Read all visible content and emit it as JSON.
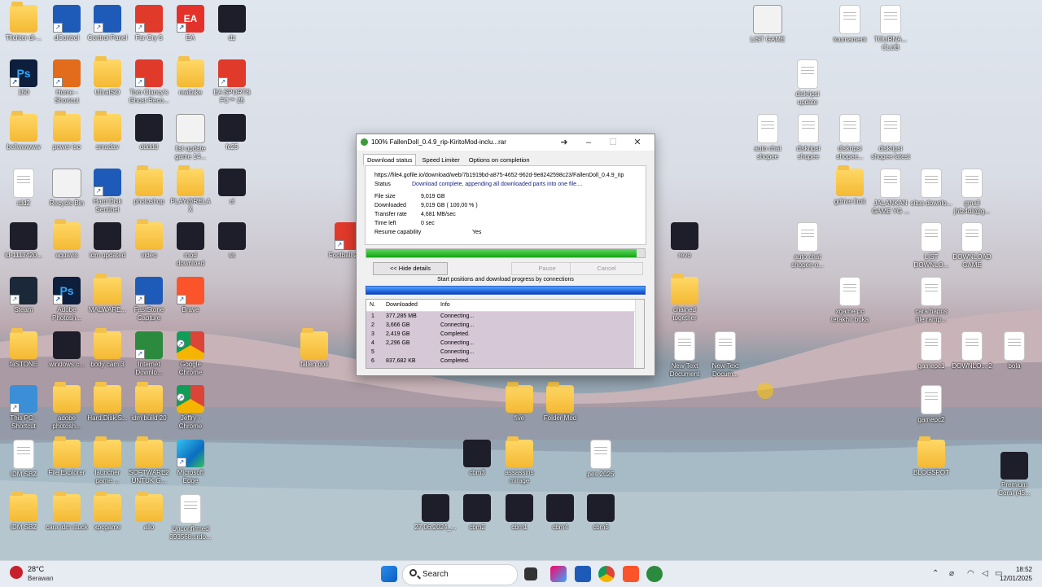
{
  "desktop_icons": [
    {
      "label": "Tfichter dl-...",
      "icon": "folder-icon"
    },
    {
      "label": "dControl",
      "icon": "app-icon"
    },
    {
      "label": "Control Panel",
      "icon": "control-panel-icon"
    },
    {
      "label": "Far Cry 5",
      "icon": "game-icon"
    },
    {
      "label": "EA",
      "icon": "ea-icon"
    },
    {
      "label": "dz",
      "icon": "image-icon"
    },
    {
      "label": "LIST GAME",
      "icon": "excel-icon"
    },
    {
      "label": "tournament",
      "icon": "document-icon"
    },
    {
      "label": "TOURNA... CLUB",
      "icon": "document-icon"
    },
    {
      "label": "150",
      "icon": "photoshop-icon"
    },
    {
      "label": "Home - Shortcut",
      "icon": "home-icon"
    },
    {
      "label": "UltraISO",
      "icon": "folder-icon"
    },
    {
      "label": "Tom Clancy's Ghost Reco...",
      "icon": "game-icon"
    },
    {
      "label": "realtake",
      "icon": "folder-icon"
    },
    {
      "label": "EA SPORTS FC™ 25",
      "icon": "game-icon"
    },
    {
      "label": "diskripsi update",
      "icon": "document-icon"
    },
    {
      "label": "bellwwwww",
      "icon": "folder-icon"
    },
    {
      "label": "power iso",
      "icon": "folder-icon"
    },
    {
      "label": "smadav",
      "icon": "folder-icon"
    },
    {
      "label": "ddddd",
      "icon": "image-icon"
    },
    {
      "label": "list update game 14...",
      "icon": "excel-icon"
    },
    {
      "label": "fc25",
      "icon": "image-icon"
    },
    {
      "label": "auto chat shopee",
      "icon": "document-icon"
    },
    {
      "label": "diskripsi shopee",
      "icon": "document-icon"
    },
    {
      "label": "diskripsi shopee...",
      "icon": "document-icon"
    },
    {
      "label": "diskripsi shopee latest",
      "icon": "document-icon"
    },
    {
      "label": "rdd2",
      "icon": "document-icon"
    },
    {
      "label": "Recycle Bin",
      "icon": "recycle-bin-icon"
    },
    {
      "label": "Hard Disk Sentinel",
      "icon": "app-icon"
    },
    {
      "label": "photoshop",
      "icon": "folder-icon"
    },
    {
      "label": "PLAY@RELAX",
      "icon": "folder-icon"
    },
    {
      "label": "cl",
      "icon": "video-icon"
    },
    {
      "label": "gdrive limit",
      "icon": "folder-icon"
    },
    {
      "label": "JALANKAN GAME YG ...",
      "icon": "document-icon"
    },
    {
      "label": "situs downlo...",
      "icon": "document-icon"
    },
    {
      "label": "gmail jhfz4dll@g...",
      "icon": "document-icon"
    },
    {
      "label": "id-1113420...",
      "icon": "image-icon"
    },
    {
      "label": "aquavis",
      "icon": "folder-icon"
    },
    {
      "label": "idm updated",
      "icon": "image-icon"
    },
    {
      "label": "video",
      "icon": "folder-icon"
    },
    {
      "label": "mod download",
      "icon": "image-icon"
    },
    {
      "label": "ss",
      "icon": "image-icon"
    },
    {
      "label": "Football 2025",
      "icon": "game-icon"
    },
    {
      "label": "revo",
      "icon": "image-icon"
    },
    {
      "label": "auto chat shopee o...",
      "icon": "document-icon"
    },
    {
      "label": "LIST DOWNLO...",
      "icon": "document-icon"
    },
    {
      "label": "DOWNLOAD GAME",
      "icon": "document-icon"
    },
    {
      "label": "Steam",
      "icon": "steam-icon"
    },
    {
      "label": "Adobe Photosh...",
      "icon": "photoshop-icon"
    },
    {
      "label": "MALWARE...",
      "icon": "folder-icon"
    },
    {
      "label": "FastStone Capture",
      "icon": "app-icon"
    },
    {
      "label": "Brave",
      "icon": "brave-icon"
    },
    {
      "label": "chained together",
      "icon": "folder-icon"
    },
    {
      "label": "xgame pc terakhir buka",
      "icon": "document-icon"
    },
    {
      "label": "cara hapus file ramp...",
      "icon": "document-icon"
    },
    {
      "label": "faSTONE",
      "icon": "folder-icon"
    },
    {
      "label": "windows c...",
      "icon": "image-icon"
    },
    {
      "label": "body cam 3",
      "icon": "folder-icon"
    },
    {
      "label": "Internet Downlo...",
      "icon": "idm-icon"
    },
    {
      "label": "Google Chrome",
      "icon": "chrome-icon"
    },
    {
      "label": "fallen doll",
      "icon": "folder-icon"
    },
    {
      "label": "New Text Document",
      "icon": "document-icon"
    },
    {
      "label": "New Text Docum...",
      "icon": "document-icon"
    },
    {
      "label": "gamepc1",
      "icon": "document-icon"
    },
    {
      "label": "DOWNLO... 2",
      "icon": "document-icon"
    },
    {
      "label": "bola",
      "icon": "document-icon"
    },
    {
      "label": "This PC - Shortcut",
      "icon": "this-pc-icon"
    },
    {
      "label": "adobe photosh...",
      "icon": "folder-icon"
    },
    {
      "label": "Hard.Disk.S...",
      "icon": "folder-icon"
    },
    {
      "label": "idm build 20",
      "icon": "folder-icon"
    },
    {
      "label": "Jeffry - Chrome",
      "icon": "chrome-icon"
    },
    {
      "label": "five",
      "icon": "folder-icon"
    },
    {
      "label": "Folder Mod",
      "icon": "folder-icon"
    },
    {
      "label": "gamepc2",
      "icon": "document-icon"
    },
    {
      "label": "IDM SBZ",
      "icon": "document-icon"
    },
    {
      "label": "File Explorer",
      "icon": "file-explorer-icon"
    },
    {
      "label": "launcher game ...",
      "icon": "folder-icon"
    },
    {
      "label": "SOFTWARE2 UNTUK G...",
      "icon": "folder-icon"
    },
    {
      "label": "Microsoft Edge",
      "icon": "edge-icon"
    },
    {
      "label": "cbm3",
      "icon": "image-icon"
    },
    {
      "label": "assassins mirage",
      "icon": "folder-icon"
    },
    {
      "label": "pes 2025",
      "icon": "document-icon"
    },
    {
      "label": "BLOGSPOT",
      "icon": "folder-icon"
    },
    {
      "label": "Premium Coral (45...",
      "icon": "image-icon"
    },
    {
      "label": "IDM SBZ",
      "icon": "folder-icon"
    },
    {
      "label": "cara idm stuck",
      "icon": "folder-icon"
    },
    {
      "label": "xpcgame",
      "icon": "folder-icon"
    },
    {
      "label": "allo",
      "icon": "folder-icon"
    },
    {
      "label": "Unconfirmed 393568.crdo...",
      "icon": "document-icon"
    },
    {
      "label": "27.06.2024_...",
      "icon": "image-icon"
    },
    {
      "label": "cbm2",
      "icon": "image-icon"
    },
    {
      "label": "cbm1",
      "icon": "image-icon"
    },
    {
      "label": "cbm4",
      "icon": "image-icon"
    },
    {
      "label": "cbm5",
      "icon": "image-icon"
    }
  ],
  "idm": {
    "title": "100% FallenDoll_0.4.9_rip-KiritoMod-inclu...rar",
    "tabs": [
      "Download status",
      "Speed Limiter",
      "Options on completion"
    ],
    "url": "https://file4.gofile.io/download/web/7b1919bd-a875-4652-962d-9e8242598c23/FallenDoll_0.4.9_rip",
    "status_label": "Status",
    "status_value": "Download complete, appending all downloaded parts into one file....",
    "fields": [
      {
        "k": "File size",
        "v": "9,019  GB"
      },
      {
        "k": "Downloaded",
        "v": "9,019  GB  ( 100,00 % )"
      },
      {
        "k": "Transfer rate",
        "v": "4,681  MB/sec"
      },
      {
        "k": "Time left",
        "v": "0 sec"
      },
      {
        "k": "Resume capability",
        "v": "Yes"
      }
    ],
    "progress": 0.97,
    "hide_details": "<< Hide details",
    "pause": "Pause",
    "cancel": "Cancel",
    "conn_caption": "Start positions and download progress by connections",
    "table_headers": [
      "N.",
      "Downloaded",
      "Info"
    ],
    "connections": [
      {
        "n": "1",
        "d": "377,285  MB",
        "i": "Connecting..."
      },
      {
        "n": "2",
        "d": "3,666  GB",
        "i": "Connecting..."
      },
      {
        "n": "3",
        "d": "2,419  GB",
        "i": "Completed."
      },
      {
        "n": "4",
        "d": "2,296  GB",
        "i": "Connecting..."
      },
      {
        "n": "5",
        "d": "",
        "i": "Connecting..."
      },
      {
        "n": "6",
        "d": "837,682  KB",
        "i": "Completed."
      }
    ]
  },
  "taskbar": {
    "temp": "28°C",
    "condition": "Berawan",
    "search_label": "Search",
    "time": "18:52",
    "date": "12/01/2025",
    "weather_badge": "1"
  },
  "colors": {
    "progress_green": "#17a317",
    "connection_blue": "#1040c8",
    "rows_bg": "#d7c8d8"
  }
}
